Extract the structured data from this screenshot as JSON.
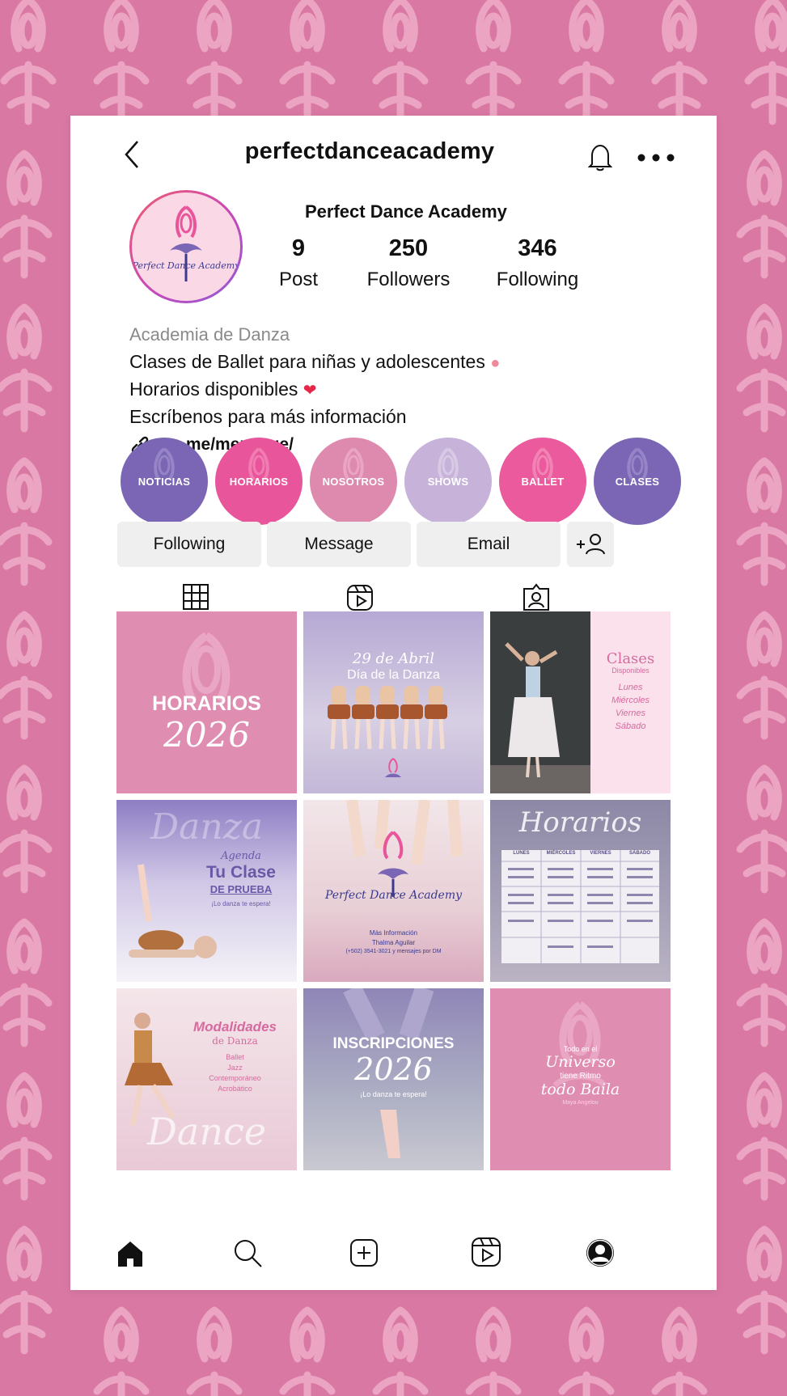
{
  "profile": {
    "username": "perfectdanceacademy",
    "display_name": "Perfect Dance Academy",
    "avatar_text": "Perfect Dance Academy",
    "stats": [
      {
        "value": "9",
        "label": "Post"
      },
      {
        "value": "250",
        "label": "Followers"
      },
      {
        "value": "346",
        "label": "Following"
      }
    ],
    "bio": {
      "category": "Academia de Danza",
      "line1": "Clases de Ballet para niñas y adolescentes",
      "line2": "Horarios disponibles",
      "line3": "Escríbenos para más información",
      "link": "wa.me/mensage/"
    }
  },
  "highlights": [
    {
      "label": "NOTICIAS",
      "color": "#7a66b4"
    },
    {
      "label": "HORARIOS",
      "color": "#e8559a"
    },
    {
      "label": "NOSOTROS",
      "color": "#de89ae"
    },
    {
      "label": "SHOWS",
      "color": "#c7b2d9"
    },
    {
      "label": "BALLET",
      "color": "#ea5a9c"
    },
    {
      "label": "CLASES",
      "color": "#7a66b4"
    }
  ],
  "actions": {
    "following": "Following",
    "message": "Message",
    "email": "Email"
  },
  "posts": {
    "p1": {
      "title": "HORARIOS",
      "year": "2026"
    },
    "p2": {
      "title": "29 de Abril",
      "subtitle": "Día de la Danza"
    },
    "p3": {
      "title": "Clases",
      "sub": "Disponibles",
      "days": [
        "Lunes",
        "Miércoles",
        "Viernes",
        "Sábado"
      ]
    },
    "p4": {
      "script": "Agenda",
      "title": "Tu Clase",
      "sub": "DE PRUEBA",
      "tag": "¡Lo danza te espera!",
      "bg_word": "Danza"
    },
    "p5": {
      "logo": "Perfect Dance Academy",
      "info1": "Más Información",
      "info2": "Thalma Aguilar",
      "info3": "(+502) 3541-3021 y mensajes por DM"
    },
    "p6": {
      "title": "Horarios",
      "cols": [
        "LUNES",
        "MIÉRCOLES",
        "VIERNES",
        "SÁBADO"
      ]
    },
    "p7": {
      "title": "Modalidades",
      "sub": "de Danza",
      "items": [
        "Ballet",
        "Jazz",
        "Contemporáneo",
        "Acrobático"
      ],
      "bg_word": "Dance"
    },
    "p8": {
      "title": "INSCRIPCIONES",
      "year": "2026",
      "tag": "¡Lo danza te espera!"
    },
    "p9": {
      "line1": "Todo en el",
      "line2": "Universo",
      "line3": "tiene Ritmo",
      "line4": "todo Baila",
      "author": "Maya Angelou"
    }
  },
  "colors": {
    "background": "#d978a3",
    "pink_tile": "#e08db2",
    "purple": "#7a66b4"
  }
}
